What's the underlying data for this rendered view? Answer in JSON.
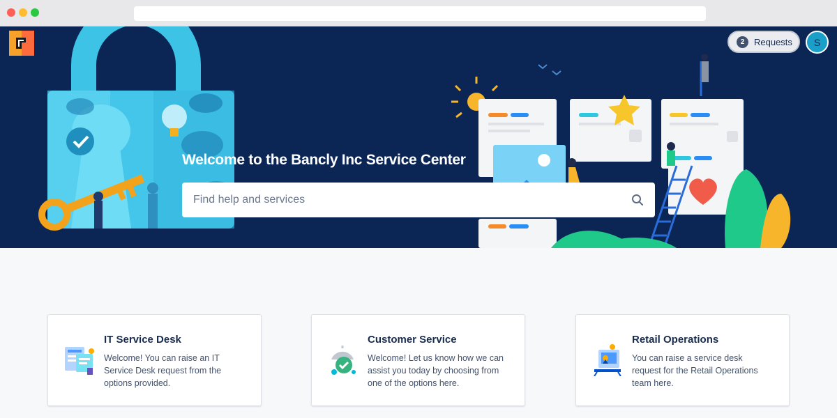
{
  "header": {
    "requests_count": "2",
    "requests_label": "Requests",
    "avatar_initial": "S"
  },
  "hero": {
    "title": "Welcome to the Bancly Inc Service Center",
    "search_placeholder": "Find help and services"
  },
  "colors": {
    "hero_background": "#0b2555",
    "page_background": "#f7f8fa",
    "text_primary": "#172b4d",
    "text_secondary": "#42526e"
  },
  "cards": [
    {
      "title": "IT Service Desk",
      "description": "Welcome! You can raise an IT Service Desk request from the options provided.",
      "icon": "it-service-desk-icon"
    },
    {
      "title": "Customer Service",
      "description": "Welcome! Let us know how we can assist you today by choosing from one of the options here.",
      "icon": "customer-service-icon"
    },
    {
      "title": "Retail Operations",
      "description": "You can raise a service desk request for the Retail Operations team here.",
      "icon": "retail-operations-icon"
    }
  ]
}
